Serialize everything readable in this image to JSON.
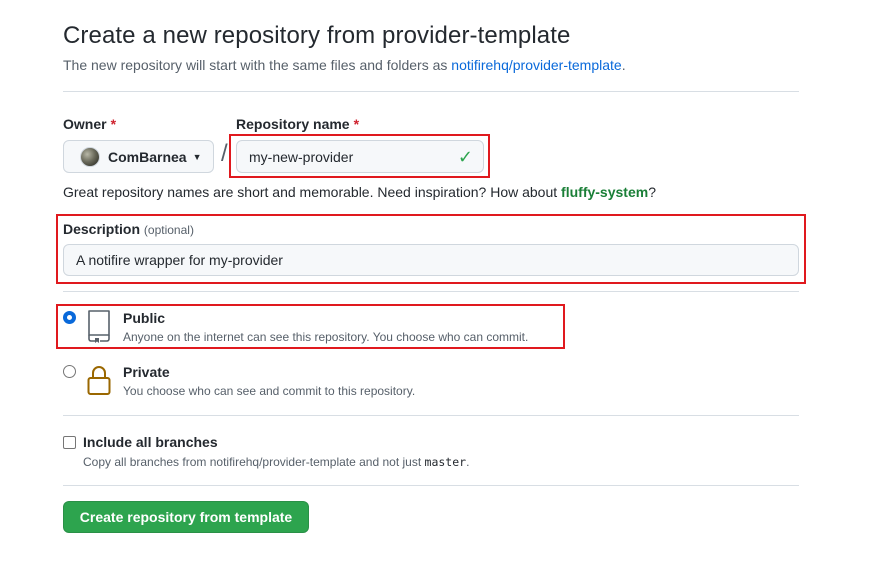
{
  "header": {
    "title": "Create a new repository from provider-template",
    "subtitle_prefix": "The new repository will start with the same files and folders as",
    "template_link": "notifirehq/provider-template",
    "subtitle_suffix": "."
  },
  "owner": {
    "label": "Owner",
    "required_mark": "*",
    "value": "ComBarnea"
  },
  "separator": "/",
  "repo_name": {
    "label": "Repository name",
    "required_mark": "*",
    "value": "my-new-provider",
    "valid_icon": "check-icon"
  },
  "name_hint": {
    "text": "Great repository names are short and memorable. Need inspiration? How about",
    "suggestion": "fluffy-system",
    "suffix": "?"
  },
  "description": {
    "label": "Description",
    "optional_note": "(optional)",
    "value": "A notifire wrapper for my-provider"
  },
  "visibility": {
    "selected": "public",
    "options": [
      {
        "title": "Public",
        "note": "Anyone on the internet can see this repository. You choose who can commit.",
        "icon": "repo-icon"
      },
      {
        "title": "Private",
        "note": "You choose who can see and commit to this repository.",
        "icon": "lock-icon"
      }
    ]
  },
  "include_branches": {
    "label": "Include all branches",
    "checked": false,
    "note_prefix": "Copy all branches from notifirehq/provider-template and not just",
    "branch": "master",
    "note_suffix": "."
  },
  "submit": {
    "label": "Create repository from template"
  },
  "colors": {
    "accent": "#0969da",
    "success": "#2da44e",
    "highlight_box": "#e0191e"
  }
}
